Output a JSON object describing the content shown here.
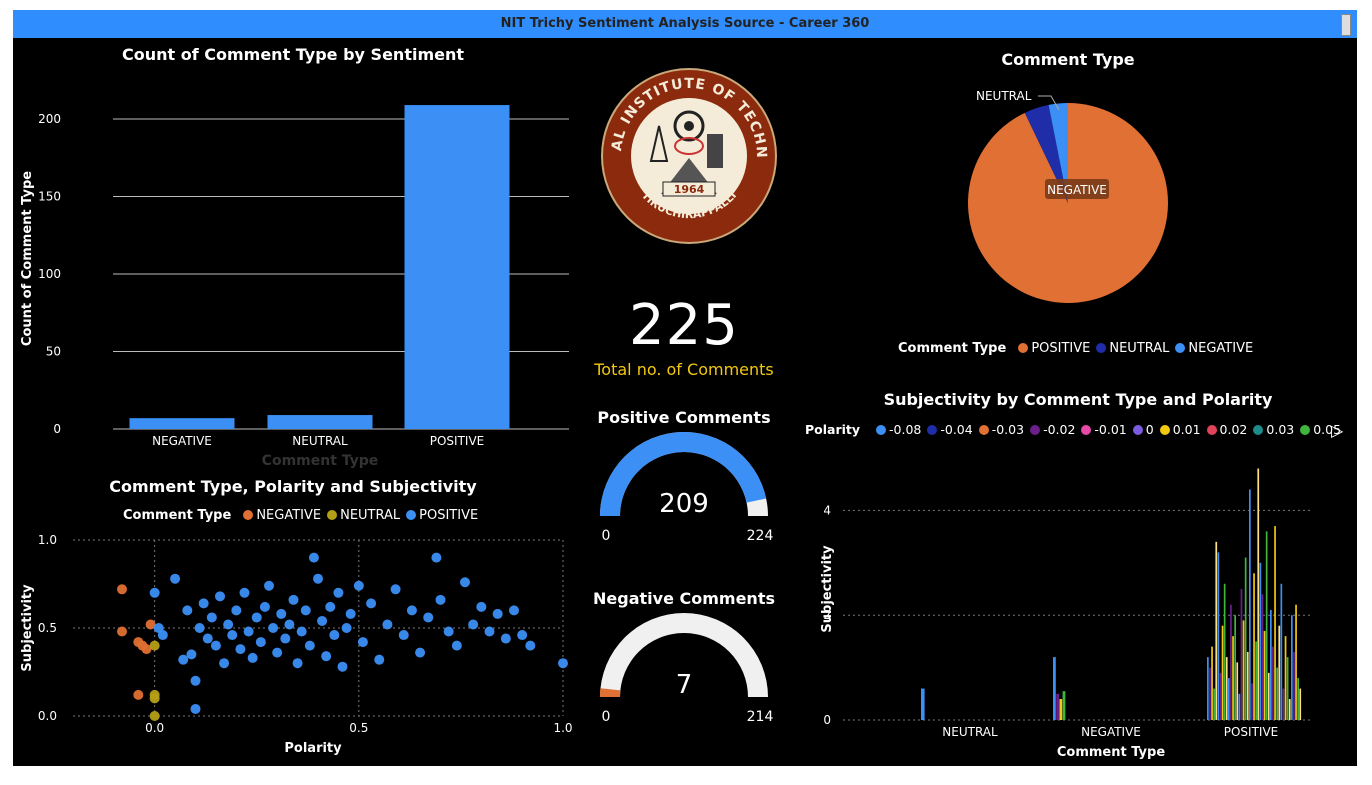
{
  "window": {
    "title": "NIT Trichy Sentiment Analysis Source - Career 360"
  },
  "colors": {
    "titlebar": "#2f8dfd",
    "positive": "#3b8ff5",
    "neutral": "#1f2ea8",
    "negative": "#e07033",
    "neutral_scatter": "#b59f16",
    "gauge_bg": "#f0f0f0",
    "card_label": "#f2c811"
  },
  "bar_chart": {
    "title": "Count of Comment Type by Sentiment",
    "xlabel": "Comment Type",
    "ylabel": "Count of Comment Type",
    "y_ticks": [
      "0",
      "50",
      "100",
      "150",
      "200"
    ]
  },
  "logo": {
    "name": "nit-trichy-logo",
    "top_text": "NATIONAL INSTITUTE OF TECHNOLOGY",
    "bottom_text": "TIRUCHIRAPPALLI",
    "year": "1964"
  },
  "card": {
    "value": "225",
    "label": "Total no. of Comments"
  },
  "gauge_positive": {
    "title": "Positive Comments",
    "value": "209",
    "min": "0",
    "max": "224",
    "fraction": 0.933
  },
  "gauge_negative": {
    "title": "Negative Comments",
    "value": "7",
    "min": "0",
    "max": "214",
    "fraction": 0.033
  },
  "pie_chart": {
    "title": "Comment Type",
    "legend_title": "Comment Type",
    "legend": [
      "POSITIVE",
      "NEUTRAL",
      "NEGATIVE"
    ],
    "labels": {
      "neutral": "NEUTRAL",
      "negative": "NEGATIVE",
      "positive": "POSITIVE"
    }
  },
  "scatter_chart": {
    "title": "Comment Type, Polarity and Subjectivity",
    "legend_title": "Comment Type",
    "legend": [
      "NEGATIVE",
      "NEUTRAL",
      "POSITIVE"
    ],
    "xlabel": "Polarity",
    "ylabel": "Subjectivity",
    "x_ticks": [
      "0.0",
      "0.5",
      "1.0"
    ],
    "y_ticks": [
      "0.0",
      "0.5",
      "1.0"
    ]
  },
  "subj_chart": {
    "title": "Subjectivity by Comment Type and Polarity",
    "legend_title": "Polarity",
    "legend": [
      "-0.08",
      "-0.04",
      "-0.03",
      "-0.02",
      "-0.01",
      "0",
      "0.01",
      "0.02",
      "0.03",
      "0.05"
    ],
    "legend_colors": [
      "#3b8ff5",
      "#1f2ea8",
      "#e07033",
      "#6b1f8a",
      "#e84aa8",
      "#7b5ce0",
      "#f2c811",
      "#e0435a",
      "#1f8a8a",
      "#3fb53f"
    ],
    "xlabel": "Comment Type",
    "ylabel": "Subjectivity",
    "y_ticks": [
      "0",
      "2",
      "4"
    ],
    "categories": [
      "NEUTRAL",
      "NEGATIVE",
      "POSITIVE"
    ]
  },
  "chart_data": [
    {
      "type": "bar",
      "title": "Count of Comment Type by Sentiment",
      "categories": [
        "NEGATIVE",
        "NEUTRAL",
        "POSITIVE"
      ],
      "values": [
        7,
        9,
        209
      ],
      "xlabel": "Comment Type",
      "ylabel": "Count of Comment Type",
      "ylim": [
        0,
        220
      ],
      "grid": true
    },
    {
      "type": "pie",
      "title": "Comment Type",
      "categories": [
        "POSITIVE",
        "NEUTRAL",
        "NEGATIVE"
      ],
      "values": [
        209,
        9,
        7
      ]
    },
    {
      "type": "scatter",
      "title": "Comment Type, Polarity and Subjectivity",
      "xlabel": "Polarity",
      "ylabel": "Subjectivity",
      "xlim": [
        -0.2,
        1.0
      ],
      "ylim": [
        0,
        1.0
      ],
      "series": [
        {
          "name": "NEGATIVE",
          "points": [
            [
              -0.08,
              0.72
            ],
            [
              -0.08,
              0.48
            ],
            [
              -0.04,
              0.42
            ],
            [
              -0.03,
              0.4
            ],
            [
              -0.02,
              0.38
            ],
            [
              -0.01,
              0.52
            ],
            [
              -0.04,
              0.12
            ]
          ]
        },
        {
          "name": "NEUTRAL",
          "points": [
            [
              0,
              0.4
            ],
            [
              0,
              0.12
            ],
            [
              0,
              0.1
            ],
            [
              0,
              0.0
            ]
          ]
        },
        {
          "name": "POSITIVE",
          "points": [
            [
              0.0,
              0.7
            ],
            [
              0.01,
              0.5
            ],
            [
              0.02,
              0.46
            ],
            [
              0.05,
              0.78
            ],
            [
              0.07,
              0.32
            ],
            [
              0.08,
              0.6
            ],
            [
              0.09,
              0.35
            ],
            [
              0.1,
              0.2
            ],
            [
              0.1,
              0.04
            ],
            [
              0.11,
              0.5
            ],
            [
              0.12,
              0.64
            ],
            [
              0.13,
              0.44
            ],
            [
              0.14,
              0.56
            ],
            [
              0.15,
              0.4
            ],
            [
              0.16,
              0.68
            ],
            [
              0.17,
              0.3
            ],
            [
              0.18,
              0.52
            ],
            [
              0.19,
              0.46
            ],
            [
              0.2,
              0.6
            ],
            [
              0.21,
              0.38
            ],
            [
              0.22,
              0.7
            ],
            [
              0.23,
              0.48
            ],
            [
              0.24,
              0.33
            ],
            [
              0.25,
              0.56
            ],
            [
              0.26,
              0.42
            ],
            [
              0.27,
              0.62
            ],
            [
              0.28,
              0.74
            ],
            [
              0.29,
              0.5
            ],
            [
              0.3,
              0.36
            ],
            [
              0.31,
              0.58
            ],
            [
              0.32,
              0.44
            ],
            [
              0.33,
              0.52
            ],
            [
              0.34,
              0.66
            ],
            [
              0.35,
              0.3
            ],
            [
              0.36,
              0.48
            ],
            [
              0.37,
              0.6
            ],
            [
              0.38,
              0.4
            ],
            [
              0.39,
              0.9
            ],
            [
              0.4,
              0.78
            ],
            [
              0.41,
              0.54
            ],
            [
              0.42,
              0.34
            ],
            [
              0.43,
              0.62
            ],
            [
              0.44,
              0.46
            ],
            [
              0.45,
              0.7
            ],
            [
              0.46,
              0.28
            ],
            [
              0.47,
              0.5
            ],
            [
              0.48,
              0.58
            ],
            [
              0.5,
              0.74
            ],
            [
              0.51,
              0.42
            ],
            [
              0.53,
              0.64
            ],
            [
              0.55,
              0.32
            ],
            [
              0.57,
              0.52
            ],
            [
              0.59,
              0.72
            ],
            [
              0.61,
              0.46
            ],
            [
              0.63,
              0.6
            ],
            [
              0.65,
              0.36
            ],
            [
              0.67,
              0.56
            ],
            [
              0.69,
              0.9
            ],
            [
              0.7,
              0.66
            ],
            [
              0.72,
              0.48
            ],
            [
              0.74,
              0.4
            ],
            [
              0.76,
              0.76
            ],
            [
              0.78,
              0.52
            ],
            [
              0.8,
              0.62
            ],
            [
              0.82,
              0.48
            ],
            [
              0.84,
              0.58
            ],
            [
              0.86,
              0.44
            ],
            [
              0.88,
              0.6
            ],
            [
              0.9,
              0.46
            ],
            [
              0.92,
              0.4
            ],
            [
              1.0,
              0.3
            ]
          ]
        }
      ]
    },
    {
      "type": "bar",
      "title": "Subjectivity by Comment Type and Polarity",
      "categories": [
        "NEUTRAL",
        "NEGATIVE",
        "POSITIVE"
      ],
      "xlabel": "Comment Type",
      "ylabel": "Subjectivity",
      "ylim": [
        0,
        5
      ],
      "series_note_values": {
        "NEUTRAL": [
          0.6
        ],
        "NEGATIVE": [
          1.2,
          0.5,
          0.4,
          0.55
        ],
        "POSITIVE": [
          1.2,
          1.0,
          1.4,
          0.6,
          3.4,
          3.2,
          0.9,
          1.8,
          2.6,
          1.2,
          0.8,
          2.2,
          1.6,
          2.0,
          1.1,
          0.5,
          2.5,
          1.9,
          3.1,
          1.3,
          4.4,
          0.7,
          2.8,
          1.5,
          4.8,
          3.0,
          2.4,
          1.7,
          3.6,
          0.9,
          2.1,
          1.4,
          3.7,
          1.0,
          1.8,
          2.6,
          0.6,
          1.6,
          1.2,
          0.4,
          2.0,
          1.3,
          2.2,
          0.8,
          0.6
        ]
      }
    }
  ]
}
